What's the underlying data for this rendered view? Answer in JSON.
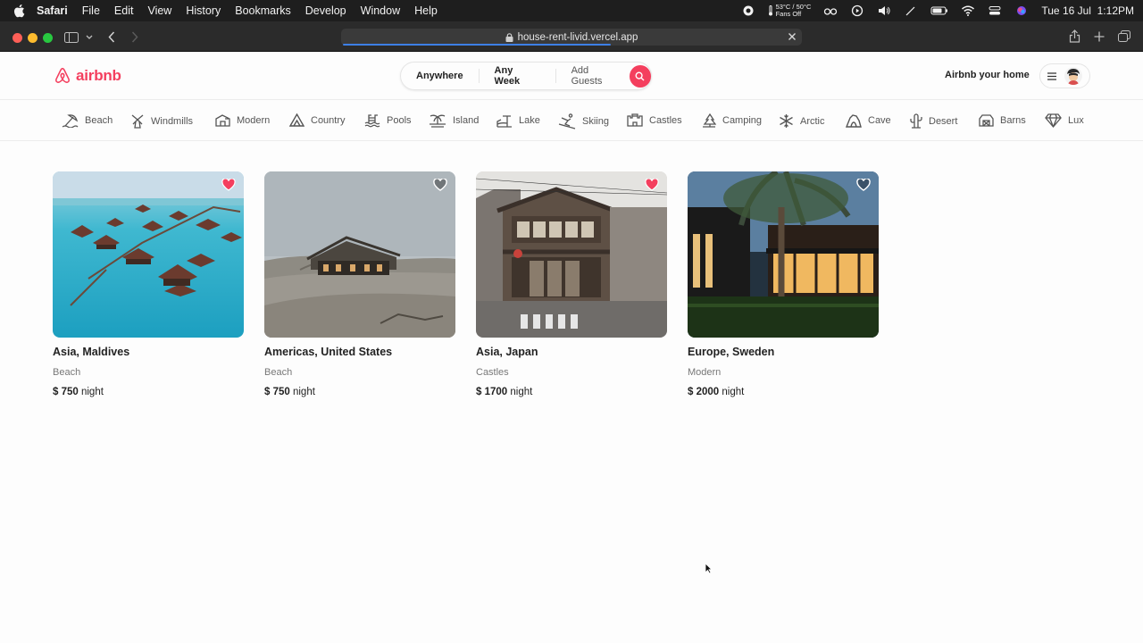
{
  "menubar": {
    "app": "Safari",
    "items": [
      "File",
      "Edit",
      "View",
      "History",
      "Bookmarks",
      "Develop",
      "Window",
      "Help"
    ],
    "temp_line1": "53°C / 50°C",
    "temp_line2": "Fans Off",
    "datetime": "Tue 16 Jul  1:12PM"
  },
  "browser": {
    "url": "house-rent-livid.vercel.app"
  },
  "header": {
    "brand": "airbnb",
    "search": {
      "location": "Anywhere",
      "dates": "Any Week",
      "guests": "Add Guests"
    },
    "host_link": "Airbnb your home",
    "accent": "#f43f5e"
  },
  "categories": [
    {
      "label": "Beach",
      "icon": "beach-icon"
    },
    {
      "label": "Windmills",
      "icon": "windmill-icon"
    },
    {
      "label": "Modern",
      "icon": "modern-icon"
    },
    {
      "label": "Country",
      "icon": "mountain-icon"
    },
    {
      "label": "Pools",
      "icon": "pool-icon"
    },
    {
      "label": "Island",
      "icon": "island-icon"
    },
    {
      "label": "Lake",
      "icon": "lake-icon"
    },
    {
      "label": "Skiing",
      "icon": "skiing-icon"
    },
    {
      "label": "Castles",
      "icon": "castle-icon"
    },
    {
      "label": "Camping",
      "icon": "forest-icon"
    },
    {
      "label": "Arctic",
      "icon": "snowflake-icon"
    },
    {
      "label": "Cave",
      "icon": "cave-icon"
    },
    {
      "label": "Desert",
      "icon": "cactus-icon"
    },
    {
      "label": "Barns",
      "icon": "barn-icon"
    },
    {
      "label": "Lux",
      "icon": "diamond-icon"
    }
  ],
  "listings": [
    {
      "location": "Asia, Maldives",
      "category": "Beach",
      "price": "$ 750",
      "unit": "night",
      "favorited": true
    },
    {
      "location": "Americas, United States",
      "category": "Beach",
      "price": "$ 750",
      "unit": "night",
      "favorited": false
    },
    {
      "location": "Asia, Japan",
      "category": "Castles",
      "price": "$ 1700",
      "unit": "night",
      "favorited": true
    },
    {
      "location": "Europe, Sweden",
      "category": "Modern",
      "price": "$ 2000",
      "unit": "night",
      "favorited": false
    }
  ]
}
